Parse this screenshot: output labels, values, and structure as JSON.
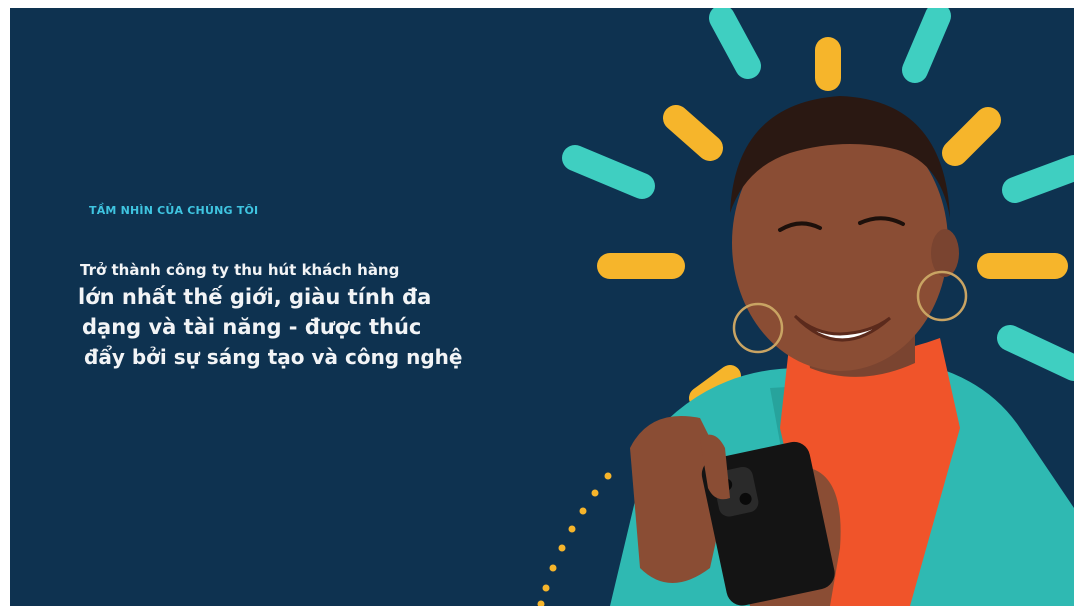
{
  "vision": {
    "eyebrow": "TẦM NHÌN CỦA CHÚNG TÔI",
    "lines": [
      "Trở thành công ty thu hút khách hàng",
      "lớn nhất thế giới, giàu tính đa",
      "dạng và tài năng - được thúc",
      "đẩy bởi sự sáng tạo và công nghệ"
    ]
  },
  "colors": {
    "background": "#0e3250",
    "teal": "#3fcfc1",
    "yellow": "#f6b52b",
    "eyebrow": "#3fc4e0",
    "text": "#f2f4f6"
  }
}
